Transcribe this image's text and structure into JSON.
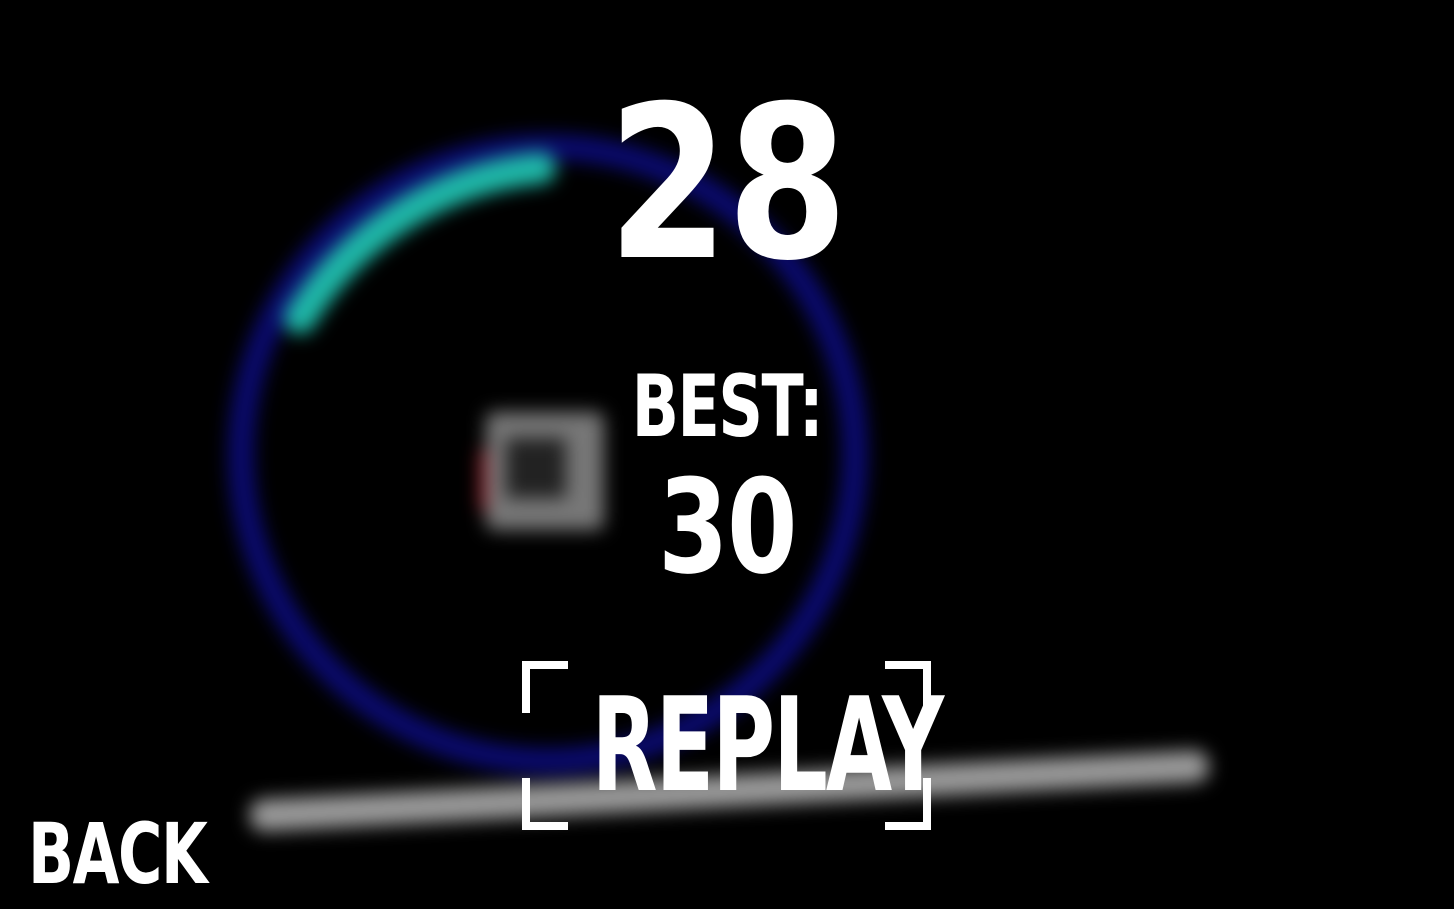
{
  "game": {
    "score": "28",
    "best_label": "BEST:",
    "best_value": "30",
    "replay_label": "REPLAY",
    "back_label": "BACK"
  },
  "colors": {
    "background": "#000000",
    "ring": "#0a0a6e",
    "ring_highlight": "#1fb8a8",
    "text": "#ffffff",
    "floor": "#9a9a9a"
  },
  "icons": {
    "replay_frame": "corner-bracket-frame"
  }
}
